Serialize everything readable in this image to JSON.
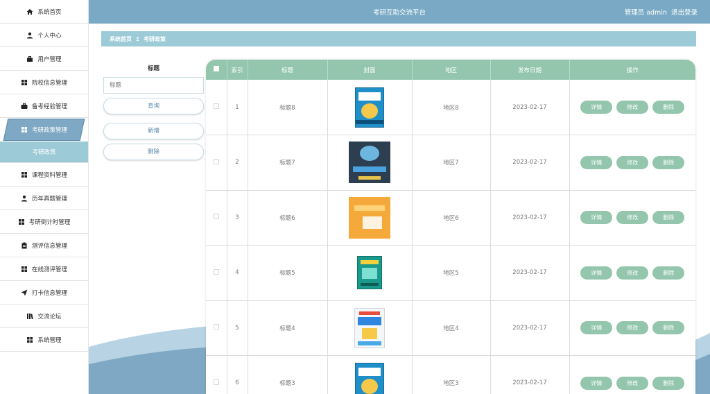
{
  "sidebar": {
    "items": [
      {
        "label": "系统首页",
        "icon": "home-icon"
      },
      {
        "label": "个人中心",
        "icon": "user-icon"
      },
      {
        "label": "用户管理",
        "icon": "briefcase-icon"
      },
      {
        "label": "院校信息管理",
        "icon": "grid-icon"
      },
      {
        "label": "备考经验管理",
        "icon": "suitcase-icon"
      },
      {
        "label": "考研政策管理",
        "icon": "grid-icon",
        "active": true,
        "sub": "考研政策"
      },
      {
        "label": "课程资料管理",
        "icon": "grid-icon"
      },
      {
        "label": "历年真题管理",
        "icon": "user-icon"
      },
      {
        "label": "考研倒计时管理",
        "icon": "grid-icon"
      },
      {
        "label": "测评信息管理",
        "icon": "clipboard-icon"
      },
      {
        "label": "在线测评管理",
        "icon": "grid-icon"
      },
      {
        "label": "打卡信息管理",
        "icon": "send-icon"
      },
      {
        "label": "交流论坛",
        "icon": "library-icon"
      },
      {
        "label": "系统管理",
        "icon": "grid-icon"
      }
    ]
  },
  "header": {
    "title": "考研互助交流平台",
    "user": "管理员 admin",
    "logout": "退出登录"
  },
  "breadcrumb": {
    "home": "系统首页",
    "separator": "Ξ",
    "current": "考研政策"
  },
  "search": {
    "label": "标题",
    "placeholder": "标题",
    "query_btn": "查询",
    "add_btn": "新增",
    "delete_btn": "删除"
  },
  "table": {
    "columns": [
      "索引",
      "标题",
      "封面",
      "地区",
      "发布日期",
      "操作"
    ],
    "rows": [
      {
        "index": "1",
        "title": "标题8",
        "region": "地区8",
        "date": "2023-02-17",
        "cover": "js-book"
      },
      {
        "index": "2",
        "title": "标题7",
        "region": "地区7",
        "date": "2023-02-17",
        "cover": "scratch-book"
      },
      {
        "index": "3",
        "title": "标题6",
        "region": "地区6",
        "date": "2023-02-17",
        "cover": "orange-book"
      },
      {
        "index": "4",
        "title": "标题5",
        "region": "地区5",
        "date": "2023-02-17",
        "cover": "teal-book"
      },
      {
        "index": "5",
        "title": "标题4",
        "region": "地区4",
        "date": "2023-02-17",
        "cover": "kids-book"
      },
      {
        "index": "6",
        "title": "标题3",
        "region": "地区3",
        "date": "2023-02-17",
        "cover": "js-book"
      }
    ],
    "actions": {
      "detail": "详情",
      "edit": "修改",
      "delete": "删除"
    }
  },
  "colors": {
    "topbar": "#79a9c4",
    "accent": "#9ccad6",
    "table_header": "#93c6ad"
  }
}
